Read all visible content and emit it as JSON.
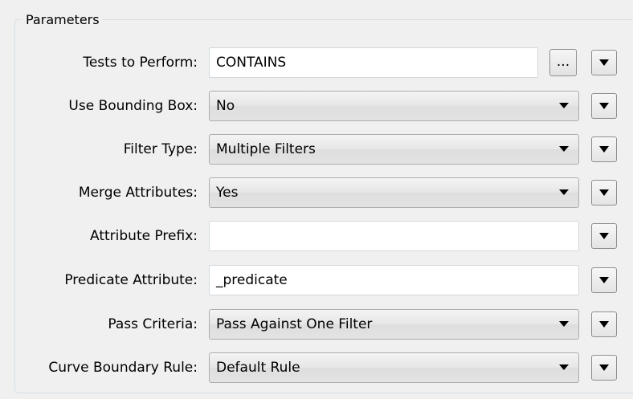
{
  "group": {
    "title": "Parameters"
  },
  "rows": [
    {
      "label": "Tests to Perform:",
      "value": "CONTAINS",
      "kind": "text-with-ellipsis",
      "ellipsis_label": "..."
    },
    {
      "label": "Use Bounding Box:",
      "value": "No",
      "kind": "combo"
    },
    {
      "label": "Filter Type:",
      "value": "Multiple Filters",
      "kind": "combo"
    },
    {
      "label": "Merge Attributes:",
      "value": "Yes",
      "kind": "combo"
    },
    {
      "label": "Attribute Prefix:",
      "value": "",
      "kind": "text"
    },
    {
      "label": "Predicate Attribute:",
      "value": "_predicate",
      "kind": "text"
    },
    {
      "label": "Pass Criteria:",
      "value": "Pass Against One Filter",
      "kind": "combo"
    },
    {
      "label": "Curve Boundary Rule:",
      "value": "Default Rule",
      "kind": "combo"
    }
  ]
}
